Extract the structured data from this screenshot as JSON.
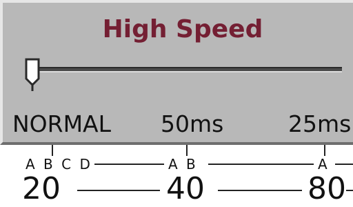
{
  "panel": {
    "title": "High Speed",
    "title_color": "#741f33",
    "background": "#b8b8b8"
  },
  "slider": {
    "position_fraction": 0.0,
    "tick_labels": [
      "NORMAL",
      "50ms",
      "25ms"
    ]
  },
  "scale": {
    "groups": [
      "A B C D",
      "A B",
      "A"
    ],
    "numbers": [
      "20",
      "40",
      "80"
    ]
  }
}
